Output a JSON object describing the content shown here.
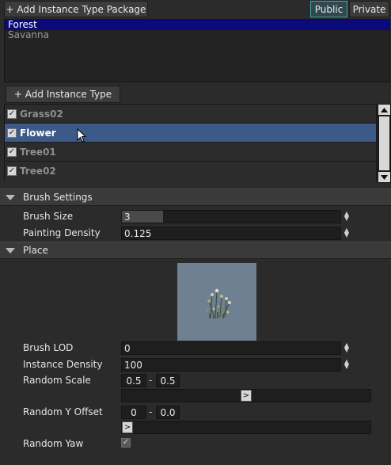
{
  "packages": {
    "add_label": "+ Add Instance Type Package",
    "public_label": "Public",
    "private_label": "Private",
    "items": [
      {
        "label": "Forest",
        "selected": true
      },
      {
        "label": "Savanna",
        "selected": false
      }
    ]
  },
  "instance_types": {
    "add_label": "+ Add Instance Type",
    "items": [
      {
        "label": "Grass02",
        "checked": true,
        "selected": false
      },
      {
        "label": "Flower",
        "checked": true,
        "selected": true
      },
      {
        "label": "Tree01",
        "checked": true,
        "selected": false
      },
      {
        "label": "Tree02",
        "checked": true,
        "selected": false
      }
    ]
  },
  "brush_settings": {
    "title": "Brush Settings",
    "brush_size_label": "Brush Size",
    "brush_size_value": "3",
    "painting_density_label": "Painting Density",
    "painting_density_value": "0.125"
  },
  "place": {
    "title": "Place",
    "brush_lod_label": "Brush LOD",
    "brush_lod_value": "0",
    "instance_density_label": "Instance Density",
    "instance_density_value": "100",
    "random_scale_label": "Random Scale",
    "random_scale_min": "0.5",
    "random_scale_max": "0.5",
    "range_sep": "-",
    "random_y_offset_label": "Random Y Offset",
    "random_y_offset_min": "0",
    "random_y_offset_max": "0.0",
    "random_yaw_label": "Random Yaw",
    "random_yaw_checked": true,
    "slider_glyph": ">"
  },
  "colors": {
    "selection_blue": "#0a0a7a",
    "row_selected": "#3c5a87",
    "preview_bg": "#6e8091"
  }
}
